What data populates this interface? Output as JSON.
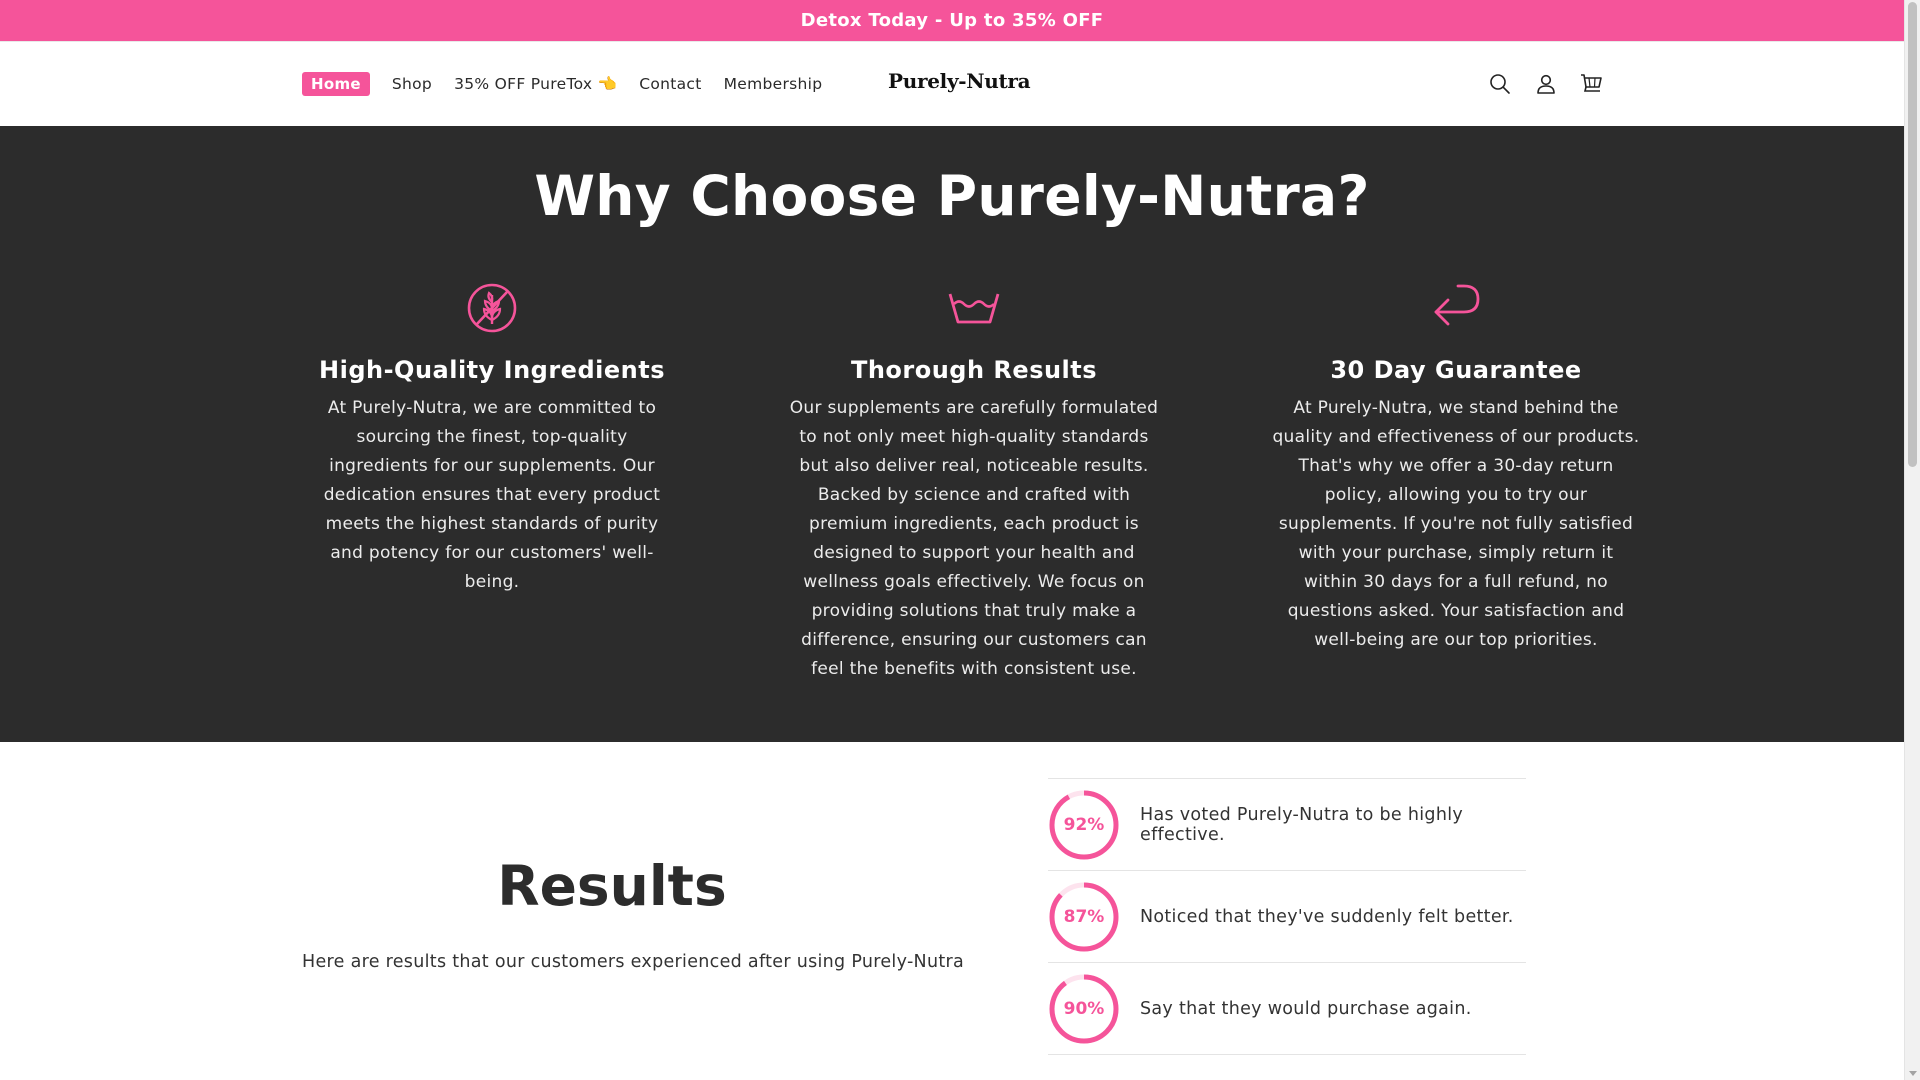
{
  "announcement": {
    "text": "Detox Today - Up to 35% OFF"
  },
  "header": {
    "logo": "Purely-Nutra",
    "nav": [
      {
        "label": "Home",
        "active": true
      },
      {
        "label": "Shop"
      },
      {
        "label": "35% OFF PureTox 👈"
      },
      {
        "label": "Contact"
      },
      {
        "label": "Membership"
      }
    ],
    "icons": [
      "search-icon",
      "account-icon",
      "cart-icon"
    ]
  },
  "why": {
    "title": "Why Choose Purely-Nutra?",
    "features": [
      {
        "icon": "wheat-icon",
        "title": "High-Quality Ingredients",
        "text": "At Purely-Nutra, we are committed to sourcing the finest, top-quality ingredients for our supplements. Our dedication ensures that every product meets the highest standards of purity and potency for our customers' well-being."
      },
      {
        "icon": "washing-bowl-icon",
        "title": "Thorough Results",
        "text": "Our supplements are carefully formulated to not only meet high-quality standards but also deliver real, noticeable results. Backed by science and crafted with premium ingredients, each product is designed to support your health and wellness goals effectively. We focus on providing solutions that truly make a difference, ensuring our customers can feel the benefits with consistent use."
      },
      {
        "icon": "return-arrow-icon",
        "title": "30 Day Guarantee",
        "text": "At Purely-Nutra, we stand behind the quality and effectiveness of our products. That's why we offer a 30-day return policy, allowing you to try our supplements. If you're not fully satisfied with your purchase, simply return it within 30 days for a full refund, no questions asked. Your satisfaction and well-being are our top priorities."
      }
    ]
  },
  "results": {
    "title": "Results",
    "subtitle": "Here are results that our customers experienced after using Purely-Nutra",
    "stats": [
      {
        "percent": 92,
        "label_pct": "92%",
        "text": "Has voted Purely-Nutra to be highly effective."
      },
      {
        "percent": 87,
        "label_pct": "87%",
        "text": "Noticed that they've suddenly felt better."
      },
      {
        "percent": 90,
        "label_pct": "90%",
        "text": "Say that they would purchase again."
      }
    ]
  },
  "colors": {
    "accent": "#f5549a",
    "dark_bg": "#2c2c2c"
  }
}
